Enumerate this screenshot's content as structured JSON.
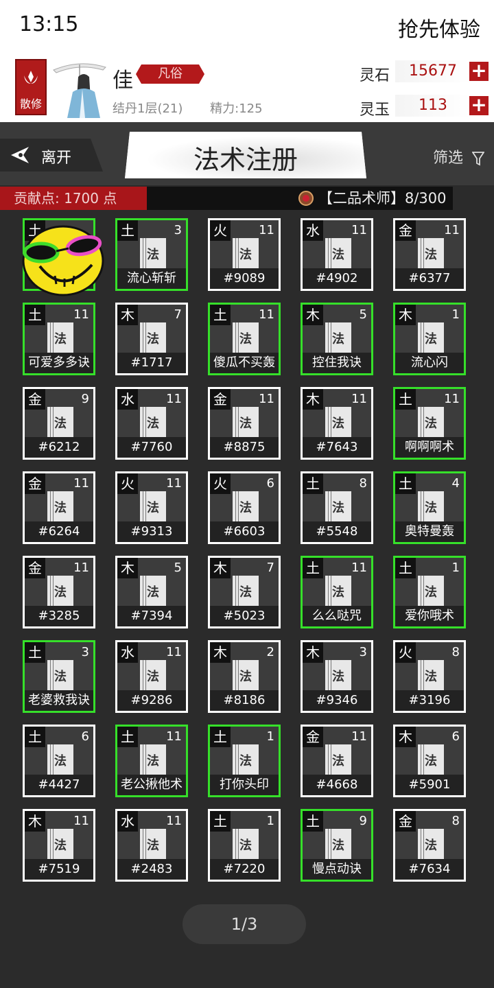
{
  "status": {
    "time": "13:15",
    "action": "抢先体验"
  },
  "player": {
    "sect_badge": "散修",
    "name": "佳",
    "rank": "凡俗",
    "realm": "结丹1层(21)",
    "energy": "精力:125"
  },
  "currency": [
    {
      "label": "灵石",
      "amount": "15677",
      "add": "+"
    },
    {
      "label": "灵玉",
      "amount": "113",
      "add": "+"
    }
  ],
  "nav": {
    "leave": "离开",
    "title": "法术注册",
    "filter": "筛选"
  },
  "info": {
    "contribution": "贡献点: 1700 点",
    "grade": "【二品术师】8/300"
  },
  "book_glyph": "法",
  "cards": [
    {
      "elem": "土",
      "lvl": "",
      "name": "",
      "green": true
    },
    {
      "elem": "土",
      "lvl": "3",
      "name": "流心斩斩",
      "green": true
    },
    {
      "elem": "火",
      "lvl": "11",
      "name": "#9089",
      "green": false
    },
    {
      "elem": "水",
      "lvl": "11",
      "name": "#4902",
      "green": false
    },
    {
      "elem": "金",
      "lvl": "11",
      "name": "#6377",
      "green": false
    },
    {
      "elem": "土",
      "lvl": "11",
      "name": "可爱多多诀",
      "green": true
    },
    {
      "elem": "木",
      "lvl": "7",
      "name": "#1717",
      "green": false
    },
    {
      "elem": "土",
      "lvl": "11",
      "name": "傻瓜不买轰",
      "green": true
    },
    {
      "elem": "木",
      "lvl": "5",
      "name": "控住我诀",
      "green": true
    },
    {
      "elem": "木",
      "lvl": "1",
      "name": "流心闪",
      "green": true
    },
    {
      "elem": "金",
      "lvl": "9",
      "name": "#6212",
      "green": false
    },
    {
      "elem": "水",
      "lvl": "11",
      "name": "#7760",
      "green": false
    },
    {
      "elem": "金",
      "lvl": "11",
      "name": "#8875",
      "green": false
    },
    {
      "elem": "木",
      "lvl": "11",
      "name": "#7643",
      "green": false
    },
    {
      "elem": "土",
      "lvl": "11",
      "name": "啊啊啊术",
      "green": true
    },
    {
      "elem": "金",
      "lvl": "11",
      "name": "#6264",
      "green": false
    },
    {
      "elem": "火",
      "lvl": "11",
      "name": "#9313",
      "green": false
    },
    {
      "elem": "火",
      "lvl": "6",
      "name": "#6603",
      "green": false
    },
    {
      "elem": "土",
      "lvl": "8",
      "name": "#5548",
      "green": false
    },
    {
      "elem": "土",
      "lvl": "4",
      "name": "奥特曼轰",
      "green": true
    },
    {
      "elem": "金",
      "lvl": "11",
      "name": "#3285",
      "green": false
    },
    {
      "elem": "木",
      "lvl": "5",
      "name": "#7394",
      "green": false
    },
    {
      "elem": "木",
      "lvl": "7",
      "name": "#5023",
      "green": false
    },
    {
      "elem": "土",
      "lvl": "11",
      "name": "么么哒咒",
      "green": true
    },
    {
      "elem": "土",
      "lvl": "1",
      "name": "爱你哦术",
      "green": true
    },
    {
      "elem": "土",
      "lvl": "3",
      "name": "老婆救我诀",
      "green": true
    },
    {
      "elem": "水",
      "lvl": "11",
      "name": "#9286",
      "green": false
    },
    {
      "elem": "木",
      "lvl": "2",
      "name": "#8186",
      "green": false
    },
    {
      "elem": "木",
      "lvl": "3",
      "name": "#9346",
      "green": false
    },
    {
      "elem": "火",
      "lvl": "8",
      "name": "#3196",
      "green": false
    },
    {
      "elem": "土",
      "lvl": "6",
      "name": "#4427",
      "green": false
    },
    {
      "elem": "土",
      "lvl": "11",
      "name": "老公揪他术",
      "green": true
    },
    {
      "elem": "土",
      "lvl": "1",
      "name": "打你头印",
      "green": true
    },
    {
      "elem": "金",
      "lvl": "11",
      "name": "#4668",
      "green": false
    },
    {
      "elem": "木",
      "lvl": "6",
      "name": "#5901",
      "green": false
    },
    {
      "elem": "木",
      "lvl": "11",
      "name": "#7519",
      "green": false
    },
    {
      "elem": "水",
      "lvl": "11",
      "name": "#2483",
      "green": false
    },
    {
      "elem": "土",
      "lvl": "1",
      "name": "#7220",
      "green": false
    },
    {
      "elem": "土",
      "lvl": "9",
      "name": "慢点动诀",
      "green": true
    },
    {
      "elem": "金",
      "lvl": "8",
      "name": "#7634",
      "green": false
    }
  ],
  "pager": "1/3",
  "colors": {
    "accent_red": "#b3191b",
    "registered_border": "#36e02a",
    "card_border": "#ffffff"
  }
}
